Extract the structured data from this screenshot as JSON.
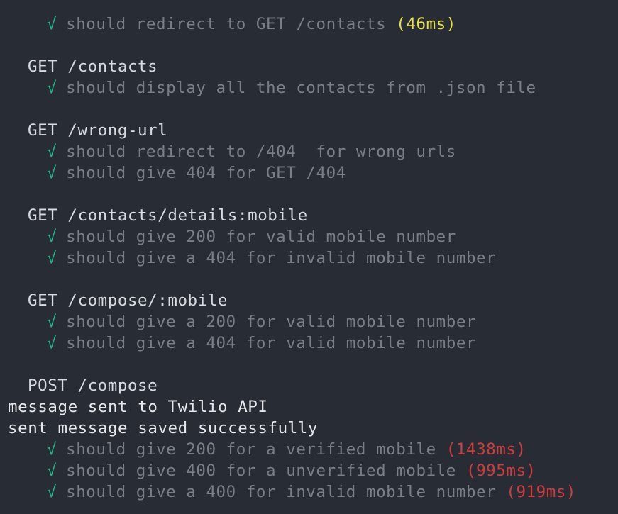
{
  "colors": {
    "background": "#282c34",
    "pass_check": "#23b68a",
    "test_title": "#7a7f87",
    "suite_title": "#d8dce2",
    "duration_medium": "#e7e04b",
    "duration_slow": "#d13b3b"
  },
  "icons": {
    "pass": "check-mark-icon",
    "pass_glyph": "√"
  },
  "lines": [
    {
      "kind": "test",
      "text": "should redirect to GET /contacts",
      "duration": "(46ms)",
      "duration_level": "medium"
    },
    {
      "kind": "blank"
    },
    {
      "kind": "suite",
      "text": "GET /contacts"
    },
    {
      "kind": "test",
      "text": "should display all the contacts from .json file"
    },
    {
      "kind": "blank"
    },
    {
      "kind": "suite",
      "text": "GET /wrong-url"
    },
    {
      "kind": "test",
      "text": "should redirect to /404  for wrong urls"
    },
    {
      "kind": "test",
      "text": "should give 404 for GET /404"
    },
    {
      "kind": "blank"
    },
    {
      "kind": "suite",
      "text": "GET /contacts/details:mobile"
    },
    {
      "kind": "test",
      "text": "should give 200 for valid mobile number"
    },
    {
      "kind": "test",
      "text": "should give a 404 for invalid mobile number"
    },
    {
      "kind": "blank"
    },
    {
      "kind": "suite",
      "text": "GET /compose/:mobile"
    },
    {
      "kind": "test",
      "text": "should give a 200 for valid mobile number"
    },
    {
      "kind": "test",
      "text": "should give a 404 for valid mobile number"
    },
    {
      "kind": "blank"
    },
    {
      "kind": "suite",
      "text": "POST /compose"
    },
    {
      "kind": "log",
      "text": "message sent to Twilio API"
    },
    {
      "kind": "log",
      "text": "sent message saved successfully"
    },
    {
      "kind": "test",
      "text": "should give 200 for a verified mobile",
      "duration": "(1438ms)",
      "duration_level": "slow"
    },
    {
      "kind": "test",
      "text": "should give 400 for a unverified mobile",
      "duration": "(995ms)",
      "duration_level": "slow"
    },
    {
      "kind": "test",
      "text": "should give a 400 for invalid mobile number",
      "duration": "(919ms)",
      "duration_level": "slow"
    }
  ]
}
